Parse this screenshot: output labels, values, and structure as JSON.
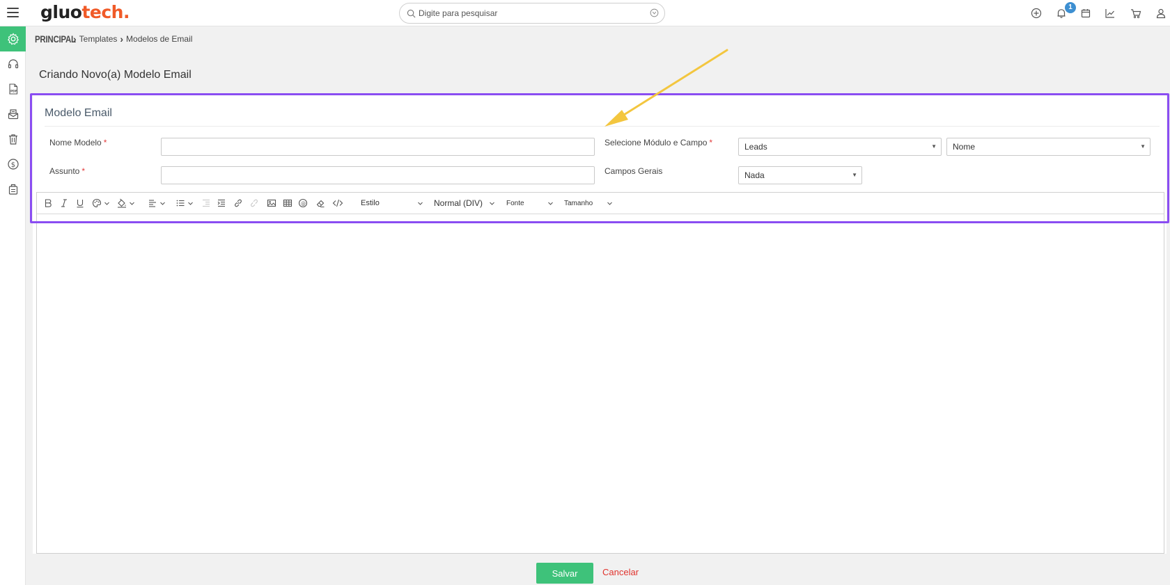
{
  "header": {
    "logo_part1": "gluo",
    "logo_part2": "tech.",
    "search_placeholder": "Digite para pesquisar",
    "notification_count": "1",
    "icons": [
      "hamburger-menu-icon",
      "search-icon",
      "filter-icon",
      "add-circle-icon",
      "bell-icon",
      "calendar-icon",
      "chart-icon",
      "cart-icon",
      "user-icon"
    ]
  },
  "sidebar": {
    "items": [
      {
        "icon": "gear-icon",
        "active": true
      },
      {
        "icon": "headset-icon",
        "active": false
      },
      {
        "icon": "pdf-icon",
        "active": false
      },
      {
        "icon": "email-template-icon",
        "active": false
      },
      {
        "icon": "trash-icon",
        "active": false
      },
      {
        "icon": "dollar-icon",
        "active": false
      },
      {
        "icon": "briefcase-icon",
        "active": false
      }
    ],
    "active_color": "#3ec27a"
  },
  "breadcrumb": {
    "root": "PRINCIPAL",
    "items": [
      "Templates",
      "Modelos de Email"
    ]
  },
  "page": {
    "title": "Criando Novo(a) Modelo Email"
  },
  "form": {
    "section_title": "Modelo Email",
    "nome_modelo_label": "Nome Modelo",
    "nome_modelo_value": "",
    "assunto_label": "Assunto",
    "assunto_value": "",
    "required_mark": "*",
    "modulo_label": "Selecione Módulo e Campo",
    "modulo_value": "Leads",
    "campo_value": "Nome",
    "campos_gerais_label": "Campos Gerais",
    "campos_gerais_value": "Nada"
  },
  "editor": {
    "style_label": "Estilo",
    "format_label": "Normal (DIV)",
    "font_label": "Fonte",
    "size_label": "Tamanho",
    "content": ""
  },
  "footer": {
    "save_label": "Salvar",
    "cancel_label": "Cancelar"
  },
  "colors": {
    "accent_green": "#3ec27a",
    "highlight_purple": "#8a4df2",
    "arrow_yellow": "#f3c63f",
    "cancel_red": "#e0332d",
    "logo_orange": "#f05a28",
    "badge_blue": "#3d8fd1"
  }
}
